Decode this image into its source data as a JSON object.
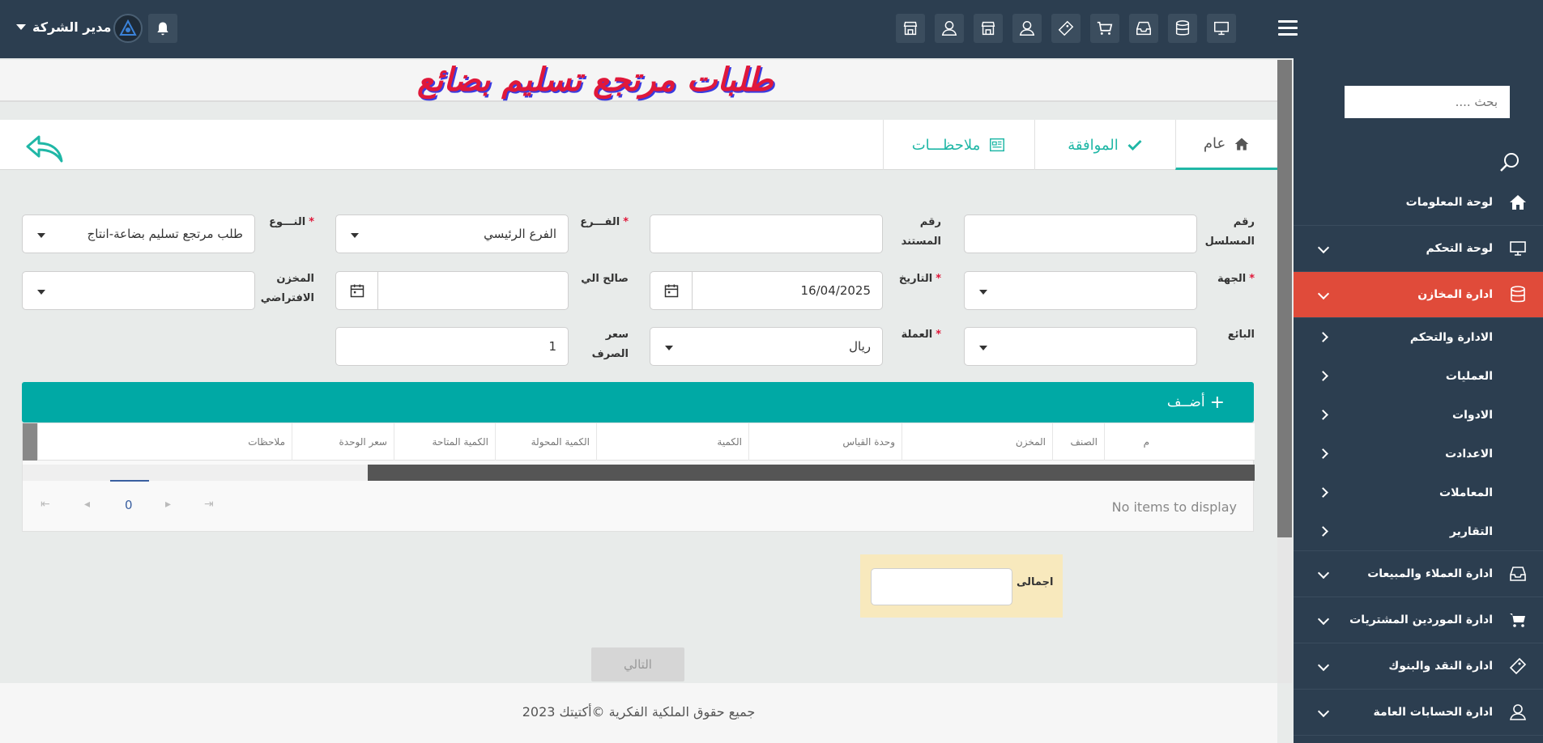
{
  "header": {
    "user_name": "مدير الشركة",
    "toolbar_icons": [
      "monitor-icon",
      "database-icon",
      "inbox-icon",
      "cart-icon",
      "ticket-icon",
      "user-icon",
      "store-icon",
      "user-icon",
      "store-icon"
    ]
  },
  "sidebar": {
    "search_placeholder": "بحث ....",
    "items": [
      {
        "label": "لوحة المعلومات",
        "icon": "home-icon"
      },
      {
        "label": "لوحة التحكم",
        "icon": "monitor-icon"
      },
      {
        "label": "ادارة المخازن",
        "icon": "database-icon",
        "active": true
      },
      {
        "label": "ادارة العملاء والمبيعات",
        "icon": "inbox-icon"
      },
      {
        "label": "ادارة الموردين المشتريات",
        "icon": "cart-icon"
      },
      {
        "label": "ادارة النقد والبنوك",
        "icon": "ticket-icon"
      },
      {
        "label": "ادارة الحسابات العامة",
        "icon": "user-icon"
      }
    ],
    "subitems": [
      "الادارة والتحكم",
      "العمليات",
      "الادوات",
      "الاعدادت",
      "المعاملات",
      "التقارير"
    ]
  },
  "page": {
    "title": "طلبات مرتجع تسليم بضائع",
    "tabs": {
      "general": "عام",
      "approval": "الموافقة",
      "notes": "ملاحظـــات"
    }
  },
  "form": {
    "serial_label": "رقم المسلسل",
    "doc_no_label": "رقم المستند",
    "branch_label": "الفـــرع",
    "branch_value": "الفرع الرئيسي",
    "type_label": "النـــوع",
    "type_value": "طلب مرتجع تسليم بضاعة-انتاج",
    "party_label": "الجهة",
    "date_label": "التاريخ",
    "date_value": "16/04/2025",
    "valid_to_label": "صالح الي",
    "default_store_label": "المخزن الافتراضي",
    "seller_label": "البائع",
    "currency_label": "العملة",
    "currency_value": "ريال",
    "rate_label": "سعر الصرف",
    "rate_value": "1"
  },
  "grid": {
    "add_label": "أضــف",
    "columns": [
      "م",
      "الصنف",
      "المخزن",
      "وحدة القياس",
      "الكمية",
      "الكمية المحولة",
      "الكمية المتاحة",
      "سعر الوحدة",
      "ملاحظات"
    ],
    "empty_text": "No items to display",
    "page_number": "0"
  },
  "total_label": "اجمالى",
  "next_label": "التالي",
  "footer": "جميع حقوق الملكية الفكرية ©أكتيتك 2023"
}
